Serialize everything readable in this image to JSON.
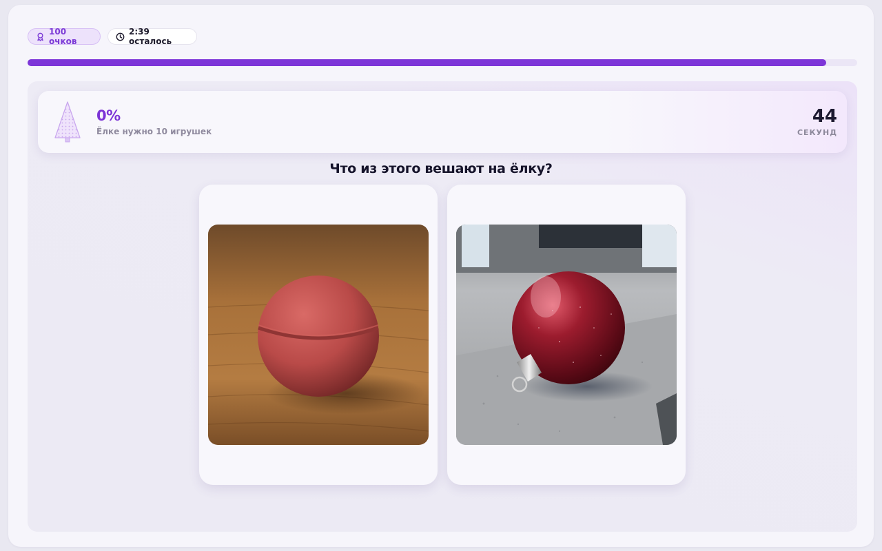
{
  "header": {
    "score_label": "100 очков",
    "time_label": "2:39 осталось",
    "progress_fraction": 0.963
  },
  "status": {
    "percent": "0%",
    "subtitle": "Ёлке нужно 10 игрушек",
    "seconds_value": "44",
    "seconds_label": "СЕКУНД"
  },
  "question": {
    "text": "Что из этого вешают на ёлку?"
  },
  "options": [
    {
      "id": "option-1",
      "icon": "bath-bomb-image"
    },
    {
      "id": "option-2",
      "icon": "christmas-ornament-image"
    }
  ],
  "colors": {
    "accent": "#7d35d8",
    "score_chip_bg": "#ede2fb",
    "text_dark": "#15132a"
  }
}
